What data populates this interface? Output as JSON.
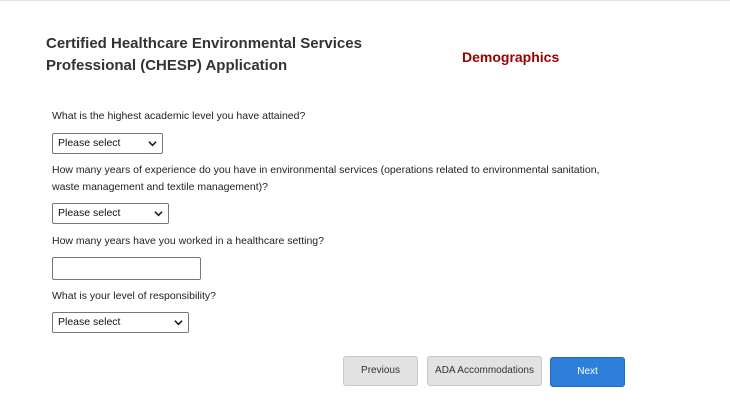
{
  "header": {
    "app_title_line1": "Certified Healthcare Environmental Services",
    "app_title_line2": "Professional (CHESP) Application",
    "section_title": "Demographics"
  },
  "form": {
    "questions": [
      {
        "label": "What is the highest academic level you have attained?",
        "type": "select",
        "value": "Please select"
      },
      {
        "label": "How many years of experience do you have in environmental services (operations related to environmental sanitation, waste management and textile management)?",
        "type": "select",
        "value": "Please select"
      },
      {
        "label": "How many years have you worked in a healthcare setting?",
        "type": "text",
        "value": ""
      },
      {
        "label": "What is your level of responsibility?",
        "type": "select",
        "value": "Please select"
      }
    ]
  },
  "buttons": {
    "previous": "Previous",
    "ada": "ADA Accommodations",
    "next": "Next"
  },
  "icons": {
    "dropdown": "chevron-down-icon"
  },
  "colors": {
    "section_title": "#990000",
    "next_button": "#2d7fd9",
    "secondary_button": "#e2e2e2"
  }
}
